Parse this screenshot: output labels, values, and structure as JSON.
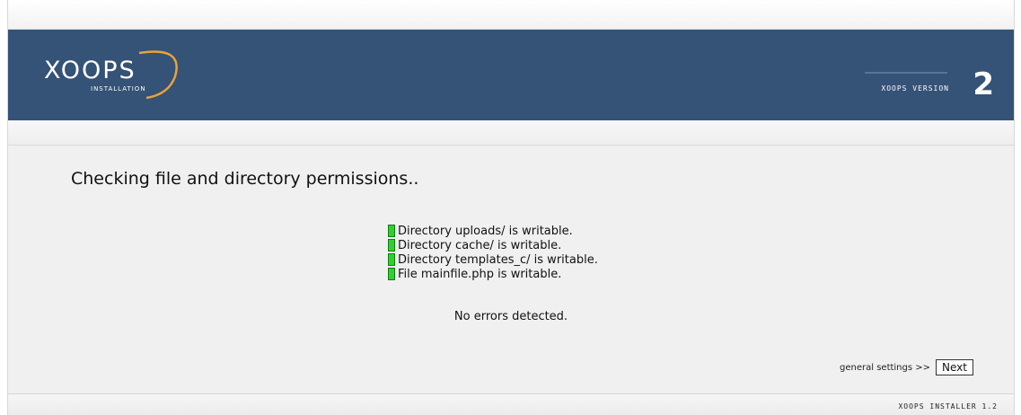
{
  "header": {
    "logo_text": "XOOPS",
    "logo_subtitle": "INSTALLATION",
    "version_label": "XOOPS VERSION",
    "version_number": "2",
    "banner_color": "#355277",
    "logo_accent_color": "#e8a33a"
  },
  "page": {
    "title": "Checking file and directory permissions..",
    "checks": [
      {
        "icon": "green-check",
        "text": "Directory uploads/ is writable."
      },
      {
        "icon": "green-check",
        "text": "Directory cache/ is writable."
      },
      {
        "icon": "green-check",
        "text": "Directory templates_c/ is writable."
      },
      {
        "icon": "green-check",
        "text": "File mainfile.php is writable."
      }
    ],
    "status": "No errors detected."
  },
  "navigation": {
    "next_caption": "general settings >>",
    "next_label": "Next"
  },
  "footer": {
    "text": "XOOPS INSTALLER 1.2"
  }
}
